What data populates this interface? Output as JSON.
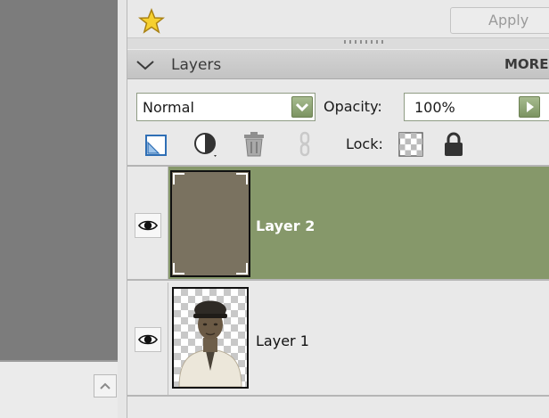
{
  "toolbar": {
    "apply_label": "Apply"
  },
  "panel": {
    "title": "Layers",
    "more_label": "MORE"
  },
  "options": {
    "blend_mode": "Normal",
    "opacity_label": "Opacity:",
    "opacity_value": "100%",
    "lock_label": "Lock:"
  },
  "layers": [
    {
      "name": "Layer 2",
      "selected": true,
      "visible": true
    },
    {
      "name": "Layer 1",
      "selected": false,
      "visible": true
    }
  ],
  "colors": {
    "selected_row": "#86986a",
    "accent_button": "#7c9462"
  },
  "icons": [
    "star-icon",
    "collapse-triangle-icon",
    "dropdown-arrow-icon",
    "play-arrow-icon",
    "new-layer-icon",
    "adjustment-layer-icon",
    "trash-icon",
    "link-icon",
    "lock-transparency-icon",
    "lock-all-icon",
    "eye-icon",
    "scroll-up-icon"
  ]
}
